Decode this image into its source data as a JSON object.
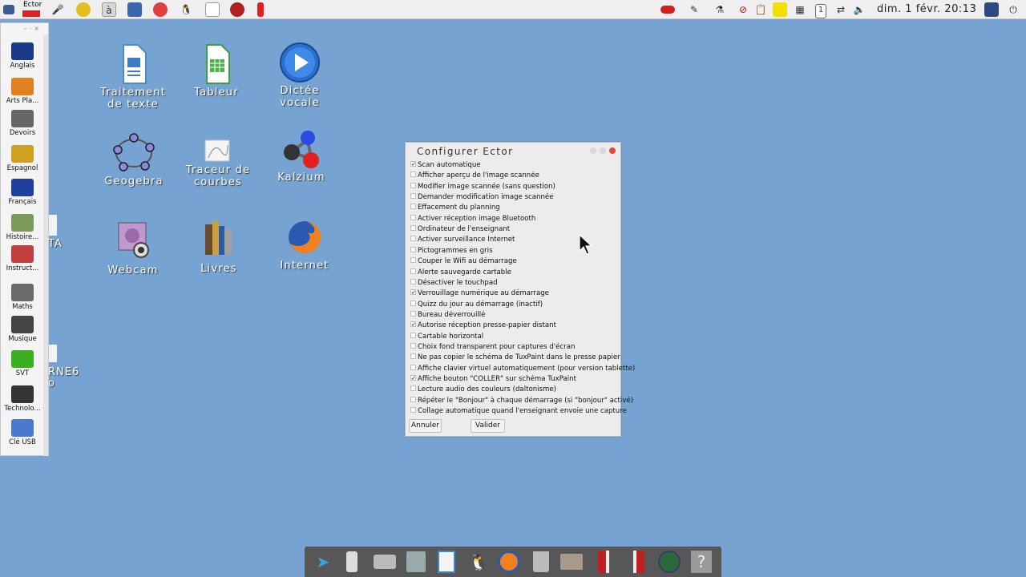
{
  "top_panel": {
    "app_name": "Ector",
    "clock": "dim.  1 févr. 20:13"
  },
  "left_dock": {
    "items": [
      {
        "label": "Anglais",
        "icon": "uk-flag-icon"
      },
      {
        "label": "Arts Pla...",
        "icon": "palette-icon"
      },
      {
        "label": "Devoirs",
        "icon": "desk-icon"
      },
      {
        "label": "Espagnol",
        "icon": "spain-flag-icon"
      },
      {
        "label": "Français",
        "icon": "france-flag-icon"
      },
      {
        "label": "Histoire...",
        "icon": "world-map-icon"
      },
      {
        "label": "Instruct...",
        "icon": "citizen-icon"
      },
      {
        "label": "Maths",
        "icon": "compass-icon"
      },
      {
        "label": "Musique",
        "icon": "music-notes-icon"
      },
      {
        "label": "SVT",
        "icon": "frog-icon"
      },
      {
        "label": "Technolo...",
        "icon": "tools-icon"
      },
      {
        "label": "Clé USB",
        "icon": "usb-key-icon"
      }
    ]
  },
  "desktop": {
    "icons": [
      {
        "label": "Traitement de texte",
        "icon": "writer-icon"
      },
      {
        "label": "Tableur",
        "icon": "calc-icon"
      },
      {
        "label": "Dictée vocale",
        "icon": "play-icon"
      },
      {
        "label": "Geogebra",
        "icon": "geogebra-icon"
      },
      {
        "label": "Traceur de courbes",
        "icon": "graph-icon"
      },
      {
        "label": "Kalzium",
        "icon": "molecule-icon"
      },
      {
        "label": "Webcam",
        "icon": "webcam-icon"
      },
      {
        "label": "Livres",
        "icon": "books-icon"
      },
      {
        "label": "Internet",
        "icon": "firefox-icon"
      }
    ],
    "partial_labels": [
      "TA",
      "RNE6",
      "o"
    ]
  },
  "dialog": {
    "title": "Configurer Ector",
    "options": [
      {
        "label": "Scan automatique",
        "checked": true
      },
      {
        "label": "Afficher aperçu de l'image scannée",
        "checked": false
      },
      {
        "label": "Modifier image scannée (sans question)",
        "checked": false
      },
      {
        "label": "Demander modification image scannée",
        "checked": false
      },
      {
        "label": "Effacement du planning",
        "checked": false
      },
      {
        "label": "Activer réception image Bluetooth",
        "checked": false
      },
      {
        "label": "Ordinateur de l'enseignant",
        "checked": false
      },
      {
        "label": "Activer surveillance Internet",
        "checked": false
      },
      {
        "label": "Pictogrammes en gris",
        "checked": false
      },
      {
        "label": "Couper le Wifi au démarrage",
        "checked": false
      },
      {
        "label": "Alerte sauvegarde cartable",
        "checked": false
      },
      {
        "label": "Désactiver le touchpad",
        "checked": false
      },
      {
        "label": "Verrouillage numérique au démarrage",
        "checked": true
      },
      {
        "label": "Quizz du jour au démarrage (inactif)",
        "checked": false
      },
      {
        "label": "Bureau déverrouillé",
        "checked": false
      },
      {
        "label": "Autorise réception presse-papier distant",
        "checked": true
      },
      {
        "label": "Cartable horizontal",
        "checked": false
      },
      {
        "label": "Choix fond transparent pour captures d'écran",
        "checked": false
      },
      {
        "label": "Ne pas copier le schéma de TuxPaint dans le presse papier",
        "checked": false
      },
      {
        "label": "Affiche clavier virtuel automatiquement (pour version tablette)",
        "checked": false
      },
      {
        "label": "Affiche bouton \"COLLER\" sur schéma TuxPaint",
        "checked": true
      },
      {
        "label": "Lecture audio des couleurs (daltonisme)",
        "checked": false
      },
      {
        "label": "Répéter le \"Bonjour\" à chaque démarrage (si \"bonjour\" activé)",
        "checked": false
      },
      {
        "label": "Collage automatique quand l'enseignant envoie une capture",
        "checked": false
      }
    ],
    "cancel_label": "Annuler",
    "ok_label": "Valider"
  },
  "colors": {
    "desktop_bg": "#76a3d1",
    "dock_bg": "#575757",
    "close_red": "#e0483e"
  }
}
